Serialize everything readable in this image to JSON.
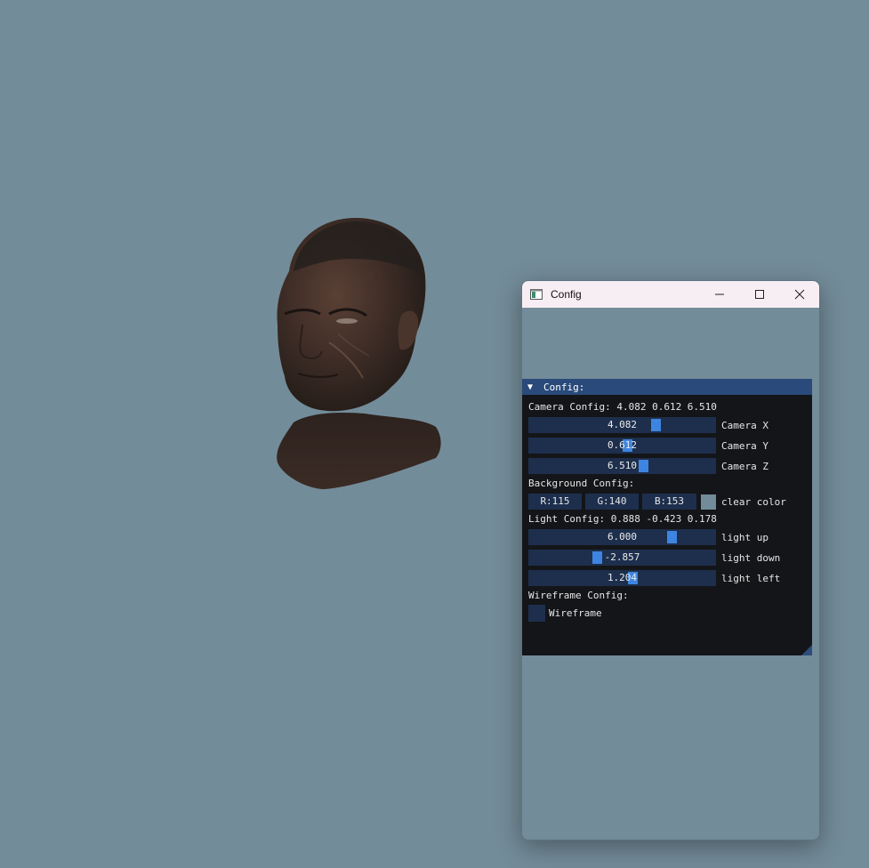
{
  "window": {
    "title": "Config"
  },
  "panel": {
    "header": "Config:",
    "camera": {
      "heading": "Camera Config: 4.082 0.612 6.510",
      "sliders": [
        {
          "value": "4.082",
          "label": "Camera X",
          "fraction": 0.69
        },
        {
          "value": "0.612",
          "label": "Camera Y",
          "fraction": 0.53
        },
        {
          "value": "6.510",
          "label": "Camera Z",
          "fraction": 0.62
        }
      ]
    },
    "background": {
      "heading": "Background Config:",
      "r": "R:115",
      "g": "G:140",
      "b": "B:153",
      "swatch_color": "#738c99",
      "label": "clear color"
    },
    "light": {
      "heading": "Light Config: 0.888 -0.423 0.178",
      "sliders": [
        {
          "value": "6.000",
          "label": "light up",
          "fraction": 0.78
        },
        {
          "value": "-2.857",
          "label": "light down",
          "fraction": 0.36
        },
        {
          "value": "1.204",
          "label": "light left",
          "fraction": 0.56
        }
      ]
    },
    "wireframe": {
      "heading": "Wireframe Config:",
      "checkbox_label": "Wireframe",
      "checked": false
    }
  },
  "colors": {
    "viewport_background": "#738c99",
    "panel_background": "#141518",
    "header_background": "#294a7a",
    "slider_track": "#1d2f4d",
    "slider_grab": "#3d85e0"
  }
}
